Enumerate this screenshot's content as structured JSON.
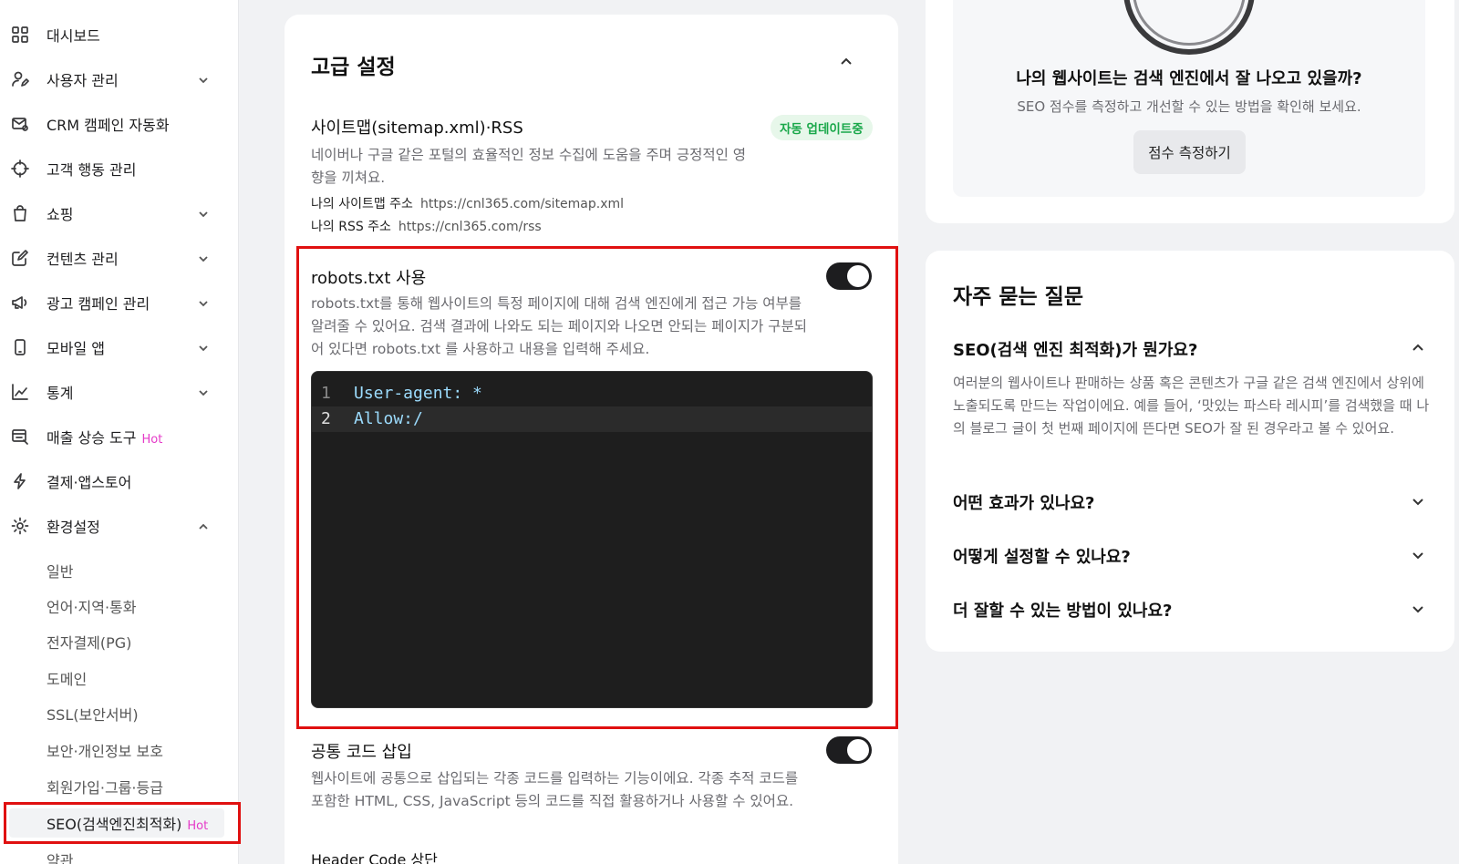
{
  "sidebar": {
    "items": [
      {
        "label": "대시보드",
        "icon": "grid-icon",
        "chevron": "none"
      },
      {
        "label": "사용자 관리",
        "icon": "user-edit-icon",
        "chevron": "down"
      },
      {
        "label": "CRM 캠페인 자동화",
        "icon": "mail-automation-icon",
        "chevron": "none"
      },
      {
        "label": "고객 행동 관리",
        "icon": "crosshair-icon",
        "chevron": "none"
      },
      {
        "label": "쇼핑",
        "icon": "shopping-bag-icon",
        "chevron": "down"
      },
      {
        "label": "컨텐츠 관리",
        "icon": "edit-icon",
        "chevron": "down"
      },
      {
        "label": "광고 캠페인 관리",
        "icon": "megaphone-icon",
        "chevron": "down"
      },
      {
        "label": "모바일 앱",
        "icon": "mobile-icon",
        "chevron": "down"
      },
      {
        "label": "통계",
        "icon": "chart-icon",
        "chevron": "down"
      },
      {
        "label": "매출 상승 도구",
        "hot": "Hot",
        "icon": "tools-icon",
        "chevron": "none"
      },
      {
        "label": "결제·앱스토어",
        "icon": "lightning-icon",
        "chevron": "none"
      },
      {
        "label": "환경설정",
        "icon": "gear-icon",
        "chevron": "up"
      }
    ],
    "sub_items": [
      {
        "label": "일반"
      },
      {
        "label": "언어·지역·통화"
      },
      {
        "label": "전자결제(PG)"
      },
      {
        "label": "도메인"
      },
      {
        "label": "SSL(보안서버)"
      },
      {
        "label": "보안·개인정보 보호"
      },
      {
        "label": "회원가입·그룹·등급"
      },
      {
        "label": "SEO(검색엔진최적화)",
        "hot": "Hot",
        "active": true
      },
      {
        "label": "약관"
      }
    ]
  },
  "main": {
    "section_title": "고급 설정",
    "sitemap": {
      "title": "사이트맵(sitemap.xml)·RSS",
      "badge": "자동 업데이트중",
      "desc": "네이버나 구글 같은 포털의 효율적인 정보 수집에 도움을 주며 긍정적인 영향을 끼쳐요.",
      "sitemap_key": "나의 사이트맵 주소",
      "sitemap_value": "https://cnl365.com/sitemap.xml",
      "rss_key": "나의 RSS 주소",
      "rss_value": "https://cnl365.com/rss"
    },
    "robots": {
      "title": "robots.txt 사용",
      "desc": "robots.txt를 통해 웹사이트의 특정 페이지에 대해 검색 엔진에게 접근 가능 여부를 알려줄 수 있어요. 검색 결과에 나와도 되는 페이지와 나오면 안되는 페이지가 구분되어 있다면 robots.txt 를 사용하고 내용을 입력해 주세요.",
      "enabled": true,
      "code_lines": [
        {
          "num": "1",
          "text": "User-agent: *"
        },
        {
          "num": "2",
          "text": "Allow:/"
        }
      ]
    },
    "common_code": {
      "title": "공통 코드 삽입",
      "desc": "웹사이트에 공통으로 삽입되는 각종 코드를 입력하는 기능이에요. 각종 추적 코드를 포함한 HTML, CSS, JavaScript 등의 코드를 직접 활용하거나 사용할 수 있어요.",
      "enabled": true,
      "header_label": "Header Code 상단"
    }
  },
  "seo_score": {
    "title": "나의 웹사이트는 검색 엔진에서 잘 나오고 있을까?",
    "desc": "SEO 점수를 측정하고 개선할 수 있는 방법을 확인해 보세요.",
    "button": "점수 측정하기"
  },
  "faq": {
    "title": "자주 묻는 질문",
    "items": [
      {
        "q": "SEO(검색 엔진 최적화)가 뭔가요?",
        "expanded": true,
        "a": "여러분의 웹사이트나 판매하는 상품 혹은 콘텐츠가 구글 같은 검색 엔진에서 상위에 노출되도록 만드는 작업이에요. 예를 들어, ‘맛있는 파스타 레시피’를 검색했을 때 나의 블로그 글이 첫 번째 페이지에 뜬다면 SEO가 잘 된 경우라고 볼 수 있어요."
      },
      {
        "q": "어떤 효과가 있나요?",
        "expanded": false
      },
      {
        "q": "어떻게 설정할 수 있나요?",
        "expanded": false
      },
      {
        "q": "더 잘할 수 있는 방법이 있나요?",
        "expanded": false
      }
    ]
  },
  "colors": {
    "highlight": "#e01010",
    "hot": "#e53ac8",
    "badge_text": "#1aa84a",
    "badge_bg": "#e7f7ea"
  }
}
